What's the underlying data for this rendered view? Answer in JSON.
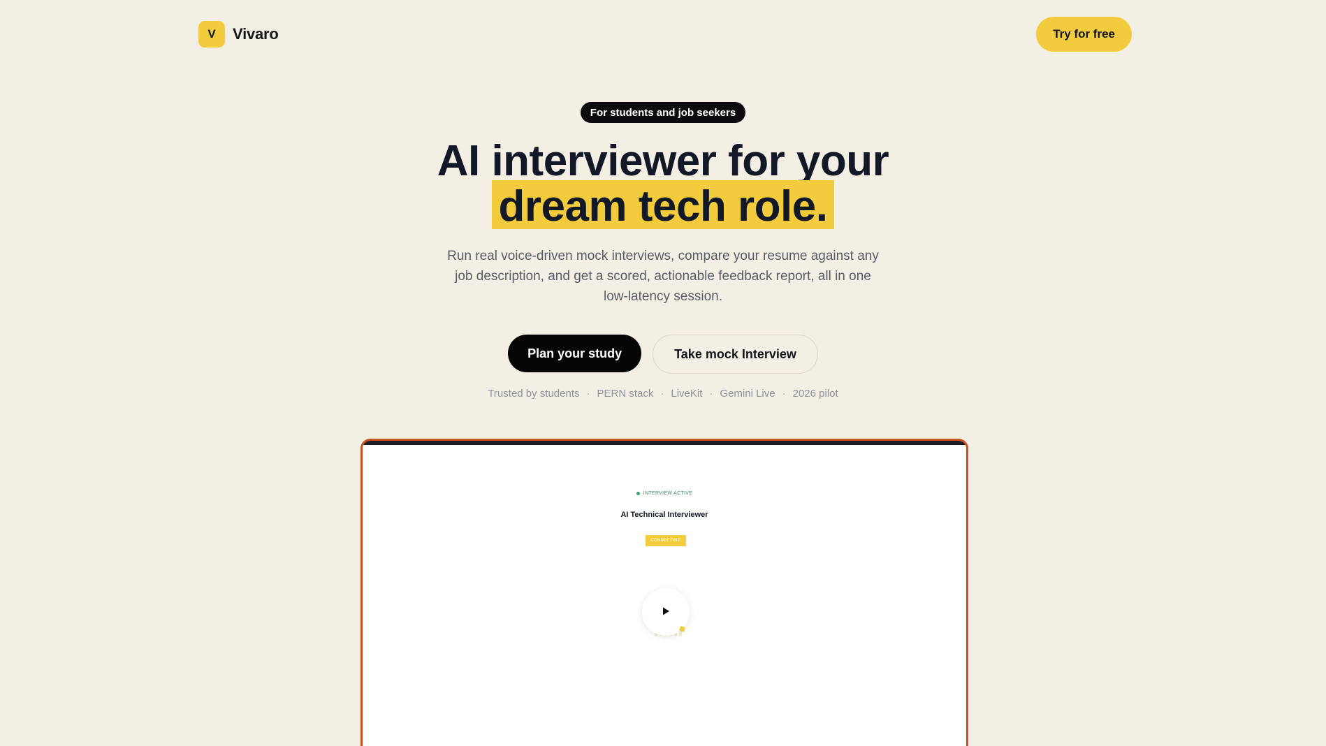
{
  "header": {
    "logo_letter": "V",
    "brand_name": "Vivaro",
    "cta_label": "Try for free"
  },
  "hero": {
    "audience_pill": "For students and job seekers",
    "headline_line1": "AI interviewer for your",
    "headline_line2": "dream tech role.",
    "subhead": "Run real voice-driven mock interviews, compare your resume against any job description, and get a scored, actionable feedback report, all in one low-latency session.",
    "primary_cta": "Plan your study",
    "secondary_cta": "Take mock Interview",
    "trust_items": [
      "Trusted by students",
      "PERN stack",
      "LiveKit",
      "Gemini Live",
      "2026 pilot"
    ],
    "trust_separator": "·"
  },
  "demo": {
    "status_label": "INTERVIEW ACTIVE",
    "title": "AI Technical Interviewer",
    "badge": "CONNECTING",
    "play_icon": "play-icon"
  },
  "colors": {
    "background": "#f4efe5",
    "accent_yellow": "#f3cc3e",
    "frame_border": "#c9521f",
    "status_green": "#3aa568",
    "end_red": "#d62e2e"
  }
}
